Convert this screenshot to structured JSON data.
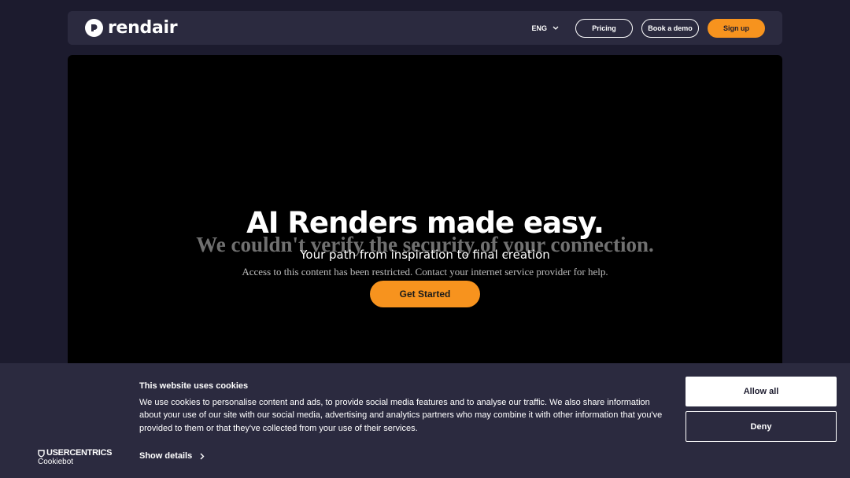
{
  "header": {
    "brand": "rendair",
    "language": "ENG",
    "pricing_label": "Pricing",
    "demo_label": "Book a demo",
    "signup_label": "Sign up"
  },
  "hero": {
    "title": "AI Renders made easy.",
    "subtitle": "Your path from inspiration to final creation",
    "cta_label": "Get Started"
  },
  "error_overlay": {
    "title": "We couldn't verify the security of your connection.",
    "message": "Access to this content has been restricted. Contact your internet service provider for help."
  },
  "cookie_banner": {
    "title": "This website uses cookies",
    "text": "We use cookies to personalise content and ads, to provide social media features and to analyse our traffic. We also share information about your use of our site with our social media, advertising and analytics partners who may combine it with other information that you've provided to them or that they've collected from your use of their services.",
    "show_details_label": "Show details",
    "allow_label": "Allow all",
    "deny_label": "Deny",
    "provider_brand": "USERCENTRICS",
    "provider_product": "Cookiebot"
  },
  "colors": {
    "accent": "#f7931e",
    "background": "#1c1b2e",
    "panel": "#2b2a3f"
  }
}
